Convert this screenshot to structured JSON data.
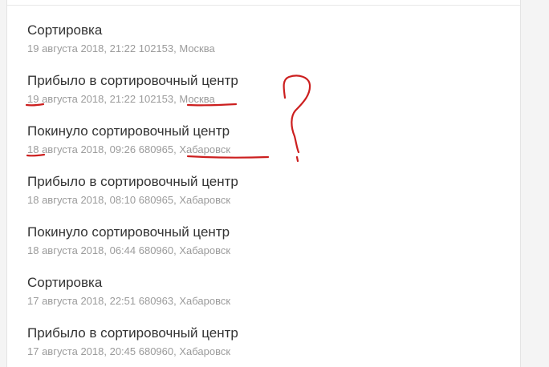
{
  "tracking": {
    "events": [
      {
        "title": "Сортировка",
        "meta": "19 августа 2018, 21:22 102153, Москва"
      },
      {
        "title": "Прибыло в сортировочный центр",
        "meta": "19 августа 2018, 21:22 102153, Москва"
      },
      {
        "title": "Покинуло сортировочный центр",
        "meta": "18 августа 2018, 09:26 680965, Хабаровск"
      },
      {
        "title": "Прибыло в сортировочный центр",
        "meta": "18 августа 2018, 08:10 680965, Хабаровск"
      },
      {
        "title": "Покинуло сортировочный центр",
        "meta": "18 августа 2018, 06:44 680960, Хабаровск"
      },
      {
        "title": "Сортировка",
        "meta": "17 августа 2018, 22:51 680963, Хабаровск"
      },
      {
        "title": "Прибыло в сортировочный центр",
        "meta": "17 августа 2018, 20:45 680960, Хабаровск"
      }
    ]
  },
  "annotation": {
    "color": "#cc1f1f",
    "mark": "?"
  }
}
